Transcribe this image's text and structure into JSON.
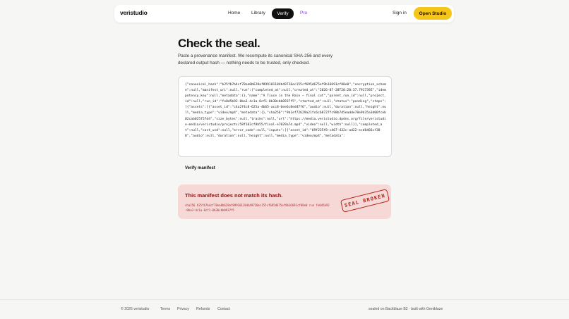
{
  "nav": {
    "logo": "veristudio",
    "home": "Home",
    "library": "Library",
    "verify": "Verify",
    "pro": "Pro",
    "sign_in": "Sign in",
    "open_studio": "Open Studio"
  },
  "hero": {
    "title": "Check the seal.",
    "subtitle": "Paste a provenance manifest. We recompute its canonical SHA-256 and every declared output hash — nothing needs to be trusted, only checked."
  },
  "manifest_input": {
    "value": "{\"canonical_hash\":\"b25fb7b4cf78ea0b628af899101184b49720ec155cf695d675ef9b16691cf88e0\",\"encryption_scheme\":null,\"manifest_uri\":null,\"run\":{\"completed_at\":null,\"created_at\":\"2026-07-28T20:20:37.791739Z\",\"idempotency_key\":null,\"metadata\":{},\"name\":\"A Tiuce in the Rain — final cut\",\"parent_run_id\":null,\"project_id\":null,\"run_id\":\"fe0d5b92-0ba3-4c1a-8cf1-0b30cbb0937f5\",\"started_at\":null,\"status\":\"pending\",\"steps\":[{\"assets\":[{\"asset_id\":\"c4a2f4c8-625a-4b65-acc8-6ee6c8ed47f6\",\"audio\":null,\"duration\":null,\"height\":null,\"media_type\":\"video/mp4\",\"metadata\":{},\"sha256\":\"9b1ef72629a21fc6c68727fc98b7d5eadde78e9d35a3d00fceb02cab025f57d4\",\"size_bytes\":null,\"tracks\":null,\"url\":\"https://media.veristudio.dpdns.org/file/veristudio-media/veristudio/projects/58f102cf8b55/final-e7029a7d.mp4\",\"video\":null,\"width\":null}],\"completed_at\":null,\"cost_usd\":null,\"error_code\":null,\"inputs\":[{\"asset_id\":\"69f235f8-c467-432c-ad22-ecd0466cf388\",\"audio\":null,\"duration\":null,\"height\":null,\"media_type\":\"video/mp4\",\"metadata\":"
  },
  "verify_button": "Verify manifest",
  "result": {
    "title": "This manifest does not match its hash.",
    "hash_line": "sha256 b25fb7b4cf78ea0b628af899101184b49720ec155cf695d675ef9b16691cf88e0 run fe0d5b92-0ba3-4c1a-8cf1-0b30cbb0937f5",
    "stamp": "SEAL BROKEN",
    "accent_color": "#b3261e"
  },
  "footer": {
    "copyright": "© 2026 veristudio",
    "links": [
      "Terms",
      "Privacy",
      "Refunds",
      "Contact"
    ],
    "credit": "sealed on Backblaze B2 · built with Geniblaze"
  },
  "colors": {
    "background": "#f6f6f4",
    "primary_button": "#f5c518",
    "active_nav": "#111111",
    "pro": "#7c3aed",
    "error_bg": "#f6d9d6"
  }
}
